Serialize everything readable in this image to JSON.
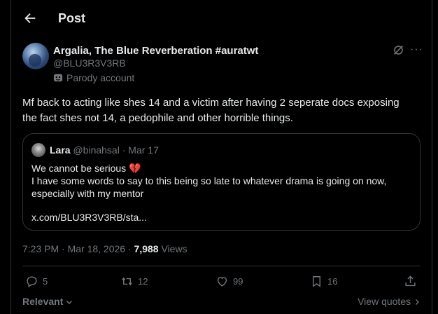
{
  "header": {
    "title": "Post"
  },
  "author": {
    "name": "Argalia, The Blue Reverberation #auratwt",
    "handle": "@BLU3R3V3RB",
    "label": "Parody account"
  },
  "post": {
    "text": "Mf back to acting like shes 14 and a victim after having 2 seperate docs exposing the fact shes not 14, a pedophile and other horrible things.",
    "timestamp": "7:23 PM · Mar 18, 2026 · ",
    "views_count": "7,988",
    "views_label": " Views"
  },
  "quote": {
    "name": "Lara",
    "handle": "@binahsal",
    "date": " · Mar 17",
    "line1": "We cannot be serious",
    "emoji": "💔",
    "line2": "I have some words to say to this being so late to whatever drama is going on now, especially with my mentor",
    "link": "x.com/BLU3R3V3RB/sta..."
  },
  "actions": {
    "replies": "5",
    "reposts": "12",
    "likes": "99",
    "bookmarks": "16"
  },
  "footer": {
    "sort": "Relevant",
    "view_quotes": "View quotes"
  },
  "colors": {
    "background": "#000000",
    "text": "#e7e9ea",
    "muted": "#71767b",
    "border": "#2f3336",
    "accent_heart": "#e0245e"
  }
}
